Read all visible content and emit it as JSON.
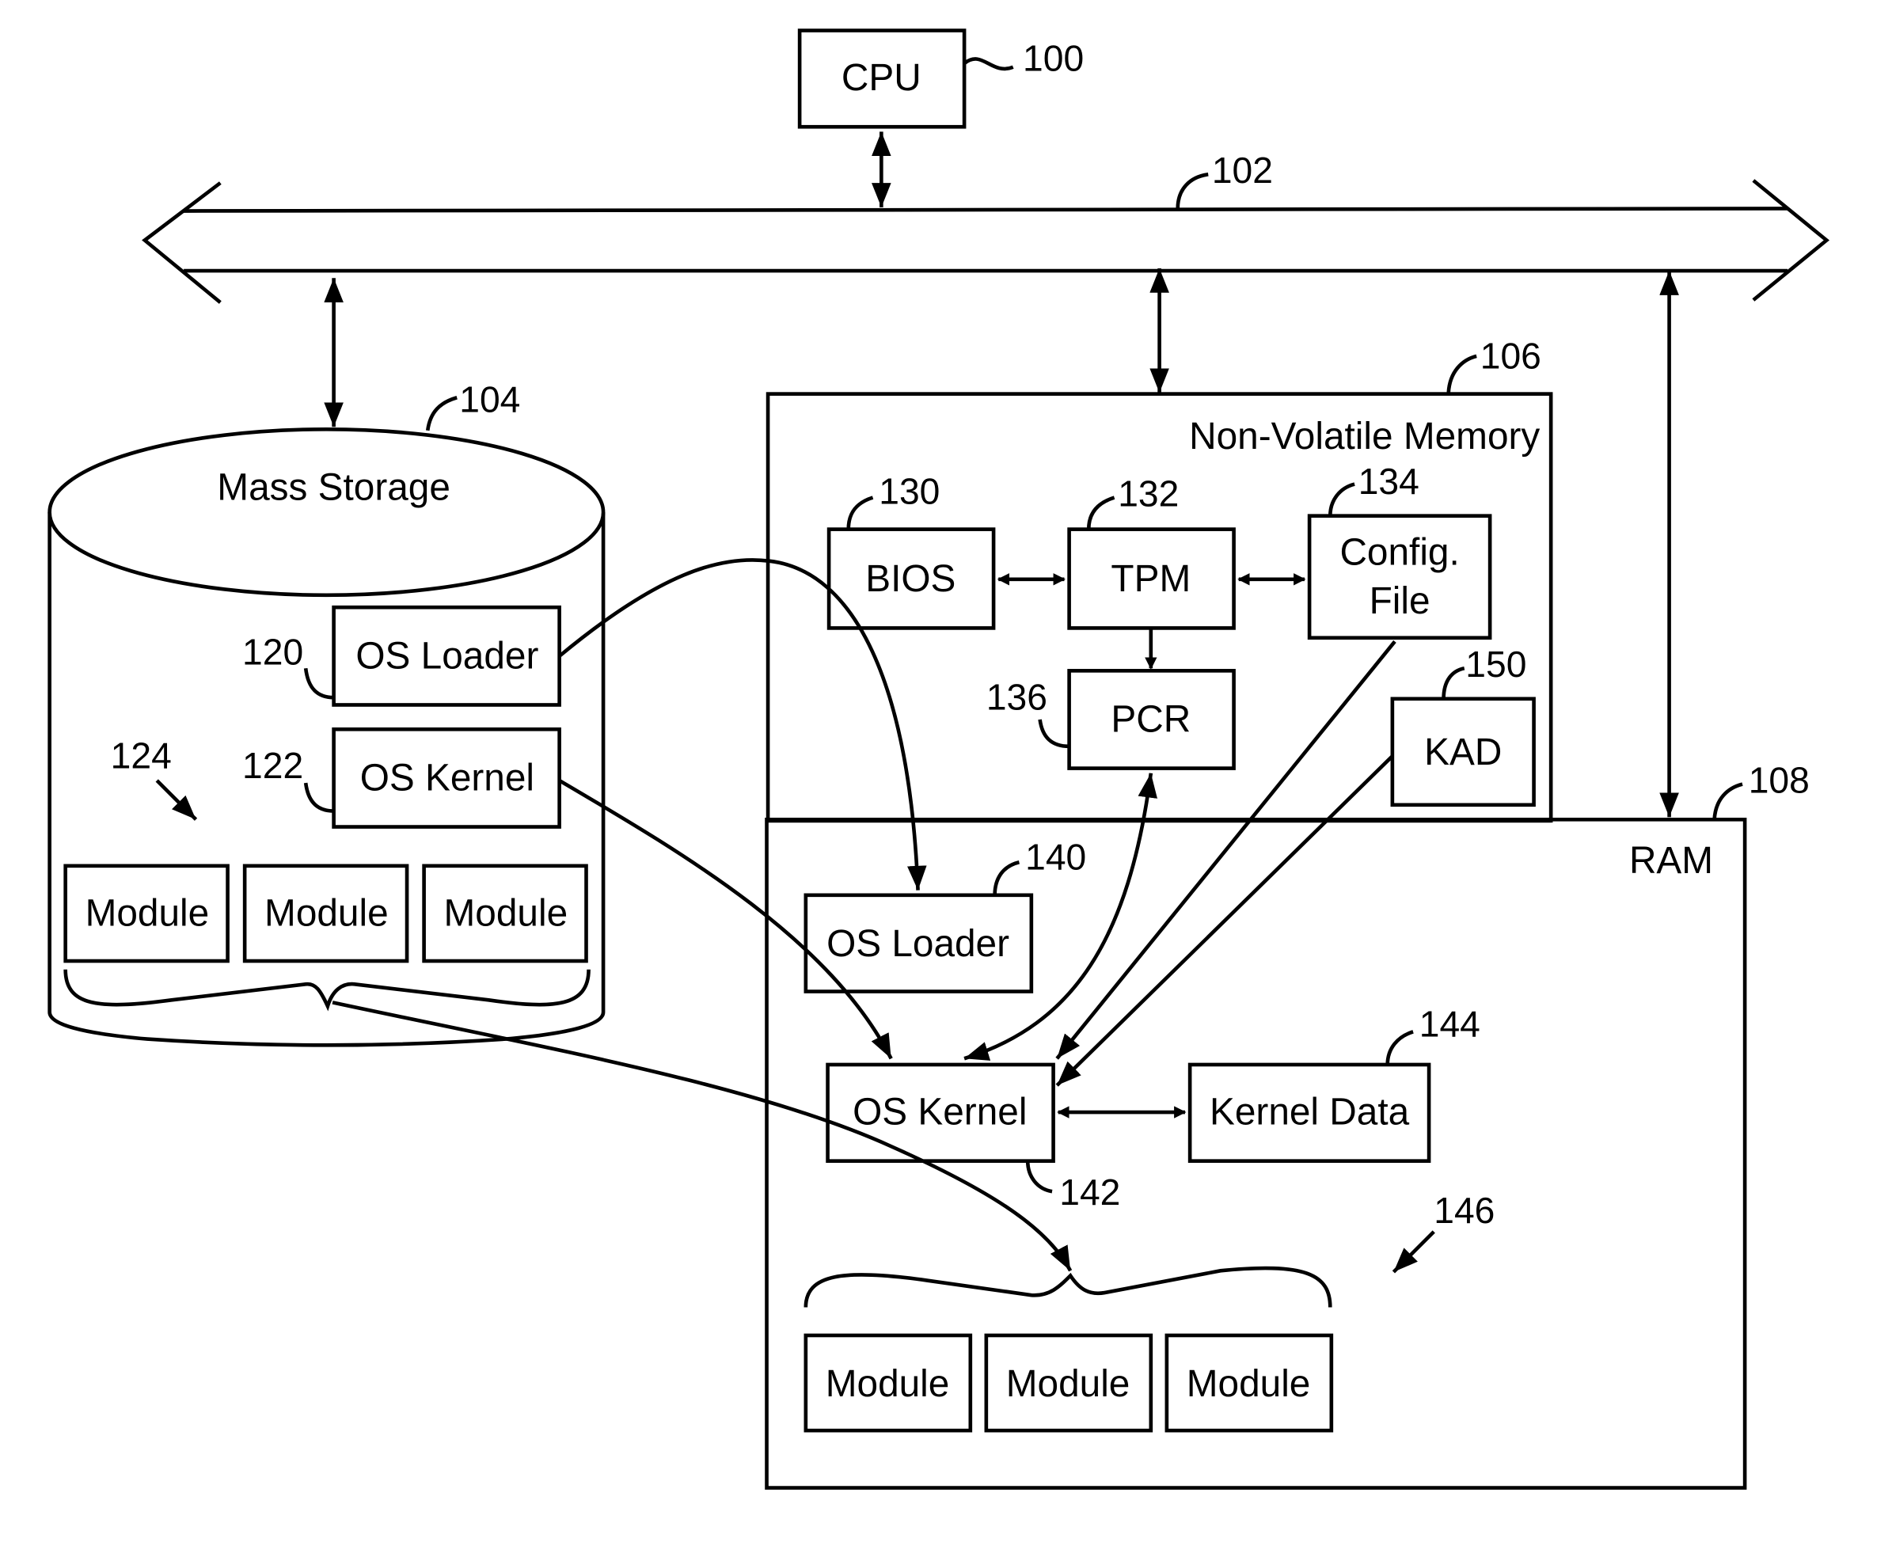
{
  "diagram": {
    "cpu": {
      "label": "CPU",
      "ref": "100"
    },
    "bus": {
      "ref": "102"
    },
    "mass_storage": {
      "label": "Mass Storage",
      "ref": "104",
      "os_loader": {
        "label": "OS Loader",
        "ref": "120"
      },
      "os_kernel": {
        "label": "OS Kernel",
        "ref": "122"
      },
      "modules_ref": "124",
      "modules": [
        "Module",
        "Module",
        "Module"
      ]
    },
    "nvm": {
      "label": "Non-Volatile Memory",
      "ref": "106",
      "bios": {
        "label": "BIOS",
        "ref": "130"
      },
      "tpm": {
        "label": "TPM",
        "ref": "132"
      },
      "config": {
        "label_line1": "Config.",
        "label_line2": "File",
        "ref": "134"
      },
      "pcr": {
        "label": "PCR",
        "ref": "136"
      },
      "kad": {
        "label": "KAD",
        "ref": "150"
      }
    },
    "ram": {
      "label": "RAM",
      "ref": "108",
      "os_loader": {
        "label": "OS Loader",
        "ref": "140"
      },
      "os_kernel": {
        "label": "OS Kernel",
        "ref": "142"
      },
      "kernel_data": {
        "label": "Kernel Data",
        "ref": "144"
      },
      "modules_ref": "146",
      "modules": [
        "Module",
        "Module",
        "Module"
      ]
    }
  }
}
